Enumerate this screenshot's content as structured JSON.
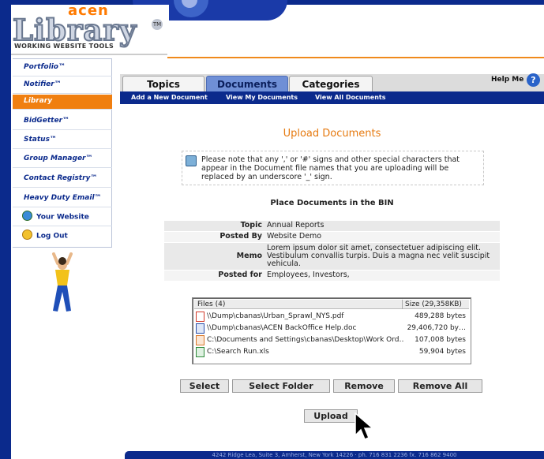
{
  "logo": {
    "brand_top": "acen",
    "brand_word": "Library",
    "trademark": "TM",
    "tagline": "WORKING WEBSITE TOOLS"
  },
  "sidebar": {
    "items": [
      {
        "label": "Portfolio™",
        "active": false
      },
      {
        "label": "Notifier™",
        "active": false
      },
      {
        "label": "Library",
        "active": true
      },
      {
        "label": "BidGetter™",
        "active": false
      },
      {
        "label": "Status™",
        "active": false
      },
      {
        "label": "Group Manager™",
        "active": false
      },
      {
        "label": "Contact Registry™",
        "active": false
      },
      {
        "label": "Heavy Duty Email™",
        "active": false
      },
      {
        "label": "Your Website",
        "active": false,
        "icon": "globe-icon"
      },
      {
        "label": "Log Out",
        "active": false,
        "icon": "logout-icon"
      }
    ]
  },
  "tabs": [
    {
      "label": "Topics",
      "active": false
    },
    {
      "label": "Documents",
      "active": true
    },
    {
      "label": "Categories",
      "active": false
    }
  ],
  "subnav": {
    "add": "Add a New Document",
    "view_my": "View My Documents",
    "view_all": "View All Documents"
  },
  "help": {
    "label": "Help Me",
    "icon_glyph": "?"
  },
  "page": {
    "heading": "Upload Documents",
    "note": "Please note that any ',' or '#' signs and other special characters that appear in the Document file names that you are uploading will be replaced by an underscore '_' sign.",
    "section_title": "Place Documents in the BIN"
  },
  "info": {
    "topic_label": "Topic",
    "topic_value": "Annual Reports",
    "posted_by_label": "Posted By",
    "posted_by_value": "Website Demo",
    "memo_label": "Memo",
    "memo_value": "Lorem ipsum dolor sit amet, consectetuer adipiscing elit. Vestibulum convallis turpis. Duis a magna nec velit suscipit vehicula.",
    "posted_for_label": "Posted for",
    "posted_for_value": "Employees, Investors,"
  },
  "file_list": {
    "header_files": "Files (4)",
    "header_size": "Size (29,358KB)",
    "rows": [
      {
        "name": "\\\\Dump\\cbanas\\Urban_Sprawl_NYS.pdf",
        "size": "489,288 bytes",
        "icon": "pdf-icon",
        "color": "#d23a2a"
      },
      {
        "name": "\\\\Dump\\cbanas\\ACEN BackOffice Help.doc",
        "size": "29,406,720 by…",
        "icon": "word-icon",
        "color": "#2b4fa8"
      },
      {
        "name": "C:\\Documents and Settings\\cbanas\\Desktop\\Work Ord…",
        "size": "107,008 bytes",
        "icon": "powerpoint-icon",
        "color": "#d9772a"
      },
      {
        "name": "C:\\Search Run.xls",
        "size": "59,904 bytes",
        "icon": "excel-icon",
        "color": "#2e8a3a"
      }
    ]
  },
  "buttons": {
    "select": "Select",
    "select_folder": "Select Folder",
    "remove": "Remove",
    "remove_all": "Remove All",
    "upload": "Upload"
  },
  "footer": {
    "text": "4242 Ridge Lea, Suite 3, Amherst, New York 14226  ·  ph. 716 831 2236  fx. 716 862 9400"
  },
  "colors": {
    "frame_blue": "#0b2a8c",
    "accent_orange": "#f07f10",
    "tab_active": "#6f8fd6"
  }
}
